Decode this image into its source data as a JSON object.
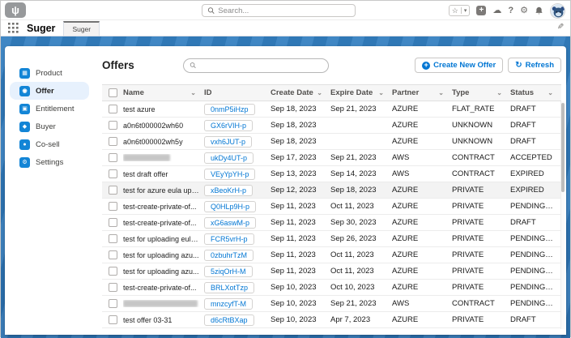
{
  "colors": {
    "accent": "#0176d3",
    "brand_band": "#2e74b7",
    "sidebar_icon": "#1385d6",
    "active_item_bg": "#e7f1fd",
    "row_highlight": "#f3f3f3"
  },
  "global_header": {
    "logo_glyph": "ψ",
    "search_placeholder": "Search...",
    "icons": {
      "favorites_star": "☆",
      "favorites_caret": "▾",
      "add": "+",
      "trailhead_cloud": "☁",
      "help": "?",
      "setup_gear": "⚙"
    }
  },
  "nav_bar": {
    "app_name": "Suger",
    "active_tab": "Suger",
    "edit_pencil": "✎"
  },
  "sidebar": {
    "items": [
      {
        "label": "Product",
        "glyph": "▦",
        "active": false
      },
      {
        "label": "Offer",
        "glyph": "◉",
        "active": true
      },
      {
        "label": "Entitlement",
        "glyph": "▣",
        "active": false
      },
      {
        "label": "Buyer",
        "glyph": "◆",
        "active": false
      },
      {
        "label": "Co-sell",
        "glyph": "●",
        "active": false
      },
      {
        "label": "Settings",
        "glyph": "⚙",
        "active": false
      }
    ]
  },
  "main": {
    "title": "Offers",
    "table_search_value": "",
    "buttons": {
      "create_label": "Create New Offer",
      "create_icon": "+",
      "refresh_label": "Refresh",
      "refresh_icon": "↻"
    },
    "table": {
      "sort_chevron": "⌄",
      "columns": [
        {
          "label": "Name",
          "sortable": true
        },
        {
          "label": "ID",
          "sortable": false
        },
        {
          "label": "Create Date",
          "sortable": true
        },
        {
          "label": "Expire Date",
          "sortable": true
        },
        {
          "label": "Partner",
          "sortable": true
        },
        {
          "label": "Type",
          "sortable": true
        },
        {
          "label": "Status",
          "sortable": true
        }
      ],
      "rows": [
        {
          "name": "test azure",
          "redacted": false,
          "id": "0nmP5iHzp",
          "create_date": "Sep 18, 2023",
          "expire_date": "Sep 21, 2023",
          "partner": "AZURE",
          "type": "FLAT_RATE",
          "status": "DRAFT",
          "highlight": false
        },
        {
          "name": "a0n6t000002wh60",
          "redacted": false,
          "id": "GX6rVIH-p",
          "create_date": "Sep 18, 2023",
          "expire_date": "",
          "partner": "AZURE",
          "type": "UNKNOWN",
          "status": "DRAFT",
          "highlight": false
        },
        {
          "name": "a0n6t000002wh5y",
          "redacted": false,
          "id": "vxh6JUT-p",
          "create_date": "Sep 18, 2023",
          "expire_date": "",
          "partner": "AZURE",
          "type": "UNKNOWN",
          "status": "DRAFT",
          "highlight": false
        },
        {
          "name": "",
          "redacted": true,
          "redacted_width": 58,
          "id": "ukDy4UT-p",
          "create_date": "Sep 17, 2023",
          "expire_date": "Sep 21, 2023",
          "partner": "AWS",
          "type": "CONTRACT",
          "status": "ACCEPTED",
          "highlight": false
        },
        {
          "name": "test draft offer",
          "redacted": false,
          "id": "VEyYpYH-p",
          "create_date": "Sep 13, 2023",
          "expire_date": "Sep 14, 2023",
          "partner": "AWS",
          "type": "CONTRACT",
          "status": "EXPIRED",
          "highlight": false
        },
        {
          "name": "test for azure eula upl...",
          "redacted": false,
          "id": "xBeoKrH-p",
          "create_date": "Sep 12, 2023",
          "expire_date": "Sep 18, 2023",
          "partner": "AZURE",
          "type": "PRIVATE",
          "status": "EXPIRED",
          "highlight": true
        },
        {
          "name": "test-create-private-of...",
          "redacted": false,
          "id": "Q0HLp9H-p",
          "create_date": "Sep 11, 2023",
          "expire_date": "Oct 11, 2023",
          "partner": "AZURE",
          "type": "PRIVATE",
          "status": "PENDING_ACCEPTAN...",
          "highlight": false
        },
        {
          "name": "test-create-private-of...",
          "redacted": false,
          "id": "xG6aswM-p",
          "create_date": "Sep 11, 2023",
          "expire_date": "Sep 30, 2023",
          "partner": "AZURE",
          "type": "PRIVATE",
          "status": "DRAFT",
          "highlight": false
        },
        {
          "name": "test for uploading eula...",
          "redacted": false,
          "id": "FCR5vrH-p",
          "create_date": "Sep 11, 2023",
          "expire_date": "Sep 26, 2023",
          "partner": "AZURE",
          "type": "PRIVATE",
          "status": "PENDING_ACCEPTAN...",
          "highlight": false
        },
        {
          "name": "test for uploading azu...",
          "redacted": false,
          "id": "0zbuhrTzM",
          "create_date": "Sep 11, 2023",
          "expire_date": "Oct 11, 2023",
          "partner": "AZURE",
          "type": "PRIVATE",
          "status": "PENDING_ACCEPTAN...",
          "highlight": false
        },
        {
          "name": "test for uploading azu...",
          "redacted": false,
          "id": "5ziqOrH-M",
          "create_date": "Sep 11, 2023",
          "expire_date": "Oct 11, 2023",
          "partner": "AZURE",
          "type": "PRIVATE",
          "status": "PENDING_ACCEPTAN...",
          "highlight": false
        },
        {
          "name": "test-create-private-of...",
          "redacted": false,
          "id": "BRLXotTzp",
          "create_date": "Sep 10, 2023",
          "expire_date": "Oct 10, 2023",
          "partner": "AZURE",
          "type": "PRIVATE",
          "status": "PENDING_ACCEPTAN...",
          "highlight": false
        },
        {
          "name": "",
          "redacted": true,
          "redacted_width": 92,
          "id": "mnzcyfT-M",
          "create_date": "Sep 10, 2023",
          "expire_date": "Sep 21, 2023",
          "partner": "AWS",
          "type": "CONTRACT",
          "status": "PENDING_ACCEPTAN...",
          "highlight": false
        },
        {
          "name": "test offer 03-31",
          "redacted": false,
          "id": "d6cRtBXap",
          "create_date": "Sep 10, 2023",
          "expire_date": "Apr 7, 2023",
          "partner": "AZURE",
          "type": "PRIVATE",
          "status": "DRAFT",
          "highlight": false
        }
      ]
    }
  }
}
